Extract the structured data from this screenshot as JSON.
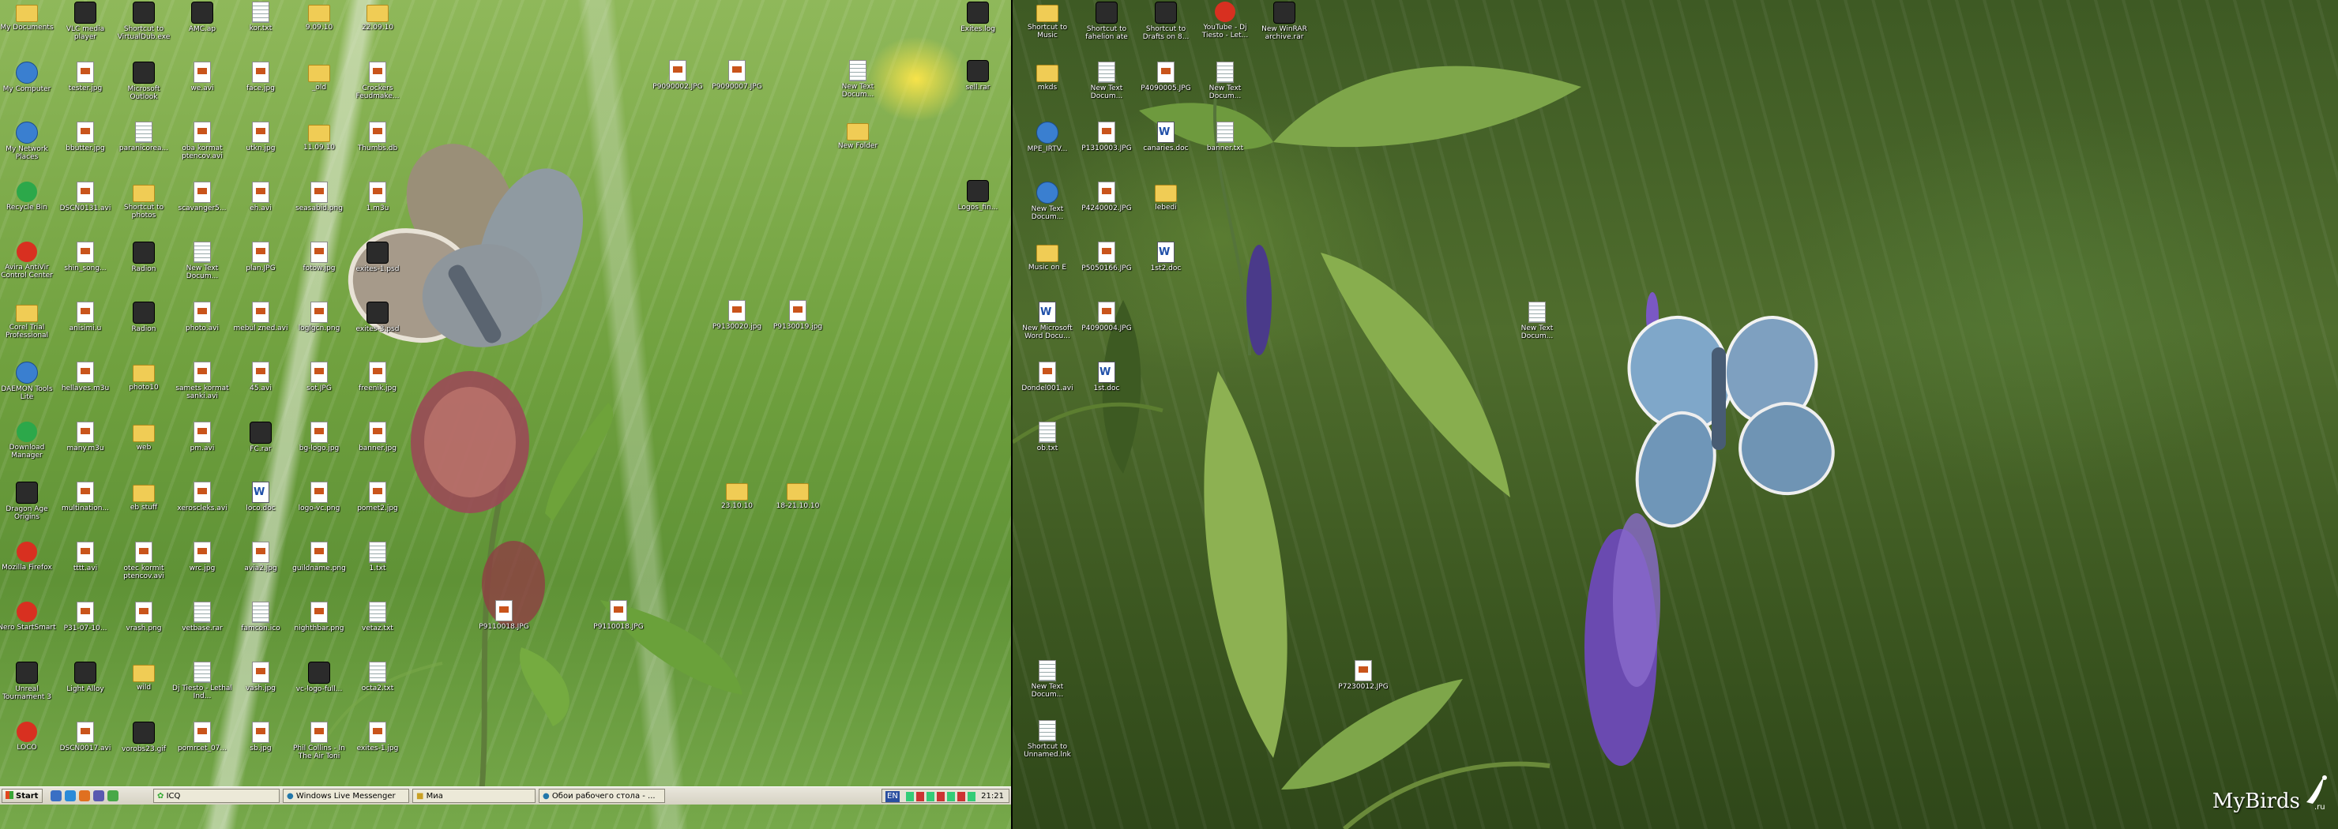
{
  "desktop_left": {
    "icons": [
      {
        "label": "My Documents",
        "type": "folder"
      },
      {
        "label": "VLC media player",
        "type": "exe"
      },
      {
        "label": "Shortcut to VirtualDub.exe",
        "type": "exe"
      },
      {
        "label": "AMC.ap",
        "type": "exe"
      },
      {
        "label": "kor.txt",
        "type": "txt"
      },
      {
        "label": "9.09.10",
        "type": "folder"
      },
      {
        "label": "22.09.10",
        "type": "folder"
      },
      {
        "label": "My Computer",
        "type": "net"
      },
      {
        "label": "tester.jpg",
        "type": "file"
      },
      {
        "label": "Microsoft Outlook",
        "type": "exe"
      },
      {
        "label": "we.avi",
        "type": "file"
      },
      {
        "label": "face.jpg",
        "type": "file"
      },
      {
        "label": "_old",
        "type": "folder"
      },
      {
        "label": "Crockers Feudmake...",
        "type": "file"
      },
      {
        "label": "My Network Places",
        "type": "net"
      },
      {
        "label": "bbutter.jpg",
        "type": "file"
      },
      {
        "label": "paranicorea...",
        "type": "txt"
      },
      {
        "label": "oba kormat ptencov.avi",
        "type": "file"
      },
      {
        "label": "utkn.jpg",
        "type": "file"
      },
      {
        "label": "11.09.10",
        "type": "folder"
      },
      {
        "label": "Thumbs.db",
        "type": "file"
      },
      {
        "label": "Recycle Bin",
        "type": "green"
      },
      {
        "label": "DSCN0131.avi",
        "type": "file"
      },
      {
        "label": "Shortcut to photos",
        "type": "folder"
      },
      {
        "label": "scavanger5...",
        "type": "file"
      },
      {
        "label": "eh.avi",
        "type": "file"
      },
      {
        "label": "seasabid.png",
        "type": "file"
      },
      {
        "label": "1.m3u",
        "type": "file"
      },
      {
        "label": "Avira AntiVir Control Center",
        "type": "red"
      },
      {
        "label": "shin_song...",
        "type": "file"
      },
      {
        "label": "Radion",
        "type": "exe"
      },
      {
        "label": "New Text Docum...",
        "type": "txt"
      },
      {
        "label": "plan.JPG",
        "type": "file"
      },
      {
        "label": "fotow.jpg",
        "type": "file"
      },
      {
        "label": "exites-1.psd",
        "type": "exe"
      },
      {
        "label": "Corel Trial Professional",
        "type": "folder"
      },
      {
        "label": "anisimi.u",
        "type": "file"
      },
      {
        "label": "Radion",
        "type": "exe"
      },
      {
        "label": "photo.avi",
        "type": "file"
      },
      {
        "label": "mebul zned.avi",
        "type": "file"
      },
      {
        "label": "loglgcn.png",
        "type": "file"
      },
      {
        "label": "exites-3.psd",
        "type": "exe"
      },
      {
        "label": "DAEMON Tools Lite",
        "type": "net"
      },
      {
        "label": "hellaves.m3u",
        "type": "file"
      },
      {
        "label": "photo10",
        "type": "folder"
      },
      {
        "label": "samets kormat sanki.avi",
        "type": "file"
      },
      {
        "label": "45.avi",
        "type": "file"
      },
      {
        "label": "sot.JPG",
        "type": "file"
      },
      {
        "label": "freenik.jpg",
        "type": "file"
      },
      {
        "label": "Download Manager",
        "type": "green"
      },
      {
        "label": "many.m3u",
        "type": "file"
      },
      {
        "label": "web",
        "type": "folder"
      },
      {
        "label": "pm.avi",
        "type": "file"
      },
      {
        "label": "FC.rar",
        "type": "exe"
      },
      {
        "label": "bg-logo.jpg",
        "type": "file"
      },
      {
        "label": "banner.jpg",
        "type": "file"
      },
      {
        "label": "Dragon Age Origins",
        "type": "exe"
      },
      {
        "label": "multination...",
        "type": "file"
      },
      {
        "label": "eb stuff",
        "type": "folder"
      },
      {
        "label": "xeroscleks.avi",
        "type": "file"
      },
      {
        "label": "loco.doc",
        "type": "doc"
      },
      {
        "label": "logo-vc.png",
        "type": "file"
      },
      {
        "label": "pomet2.jpg",
        "type": "file"
      },
      {
        "label": "Mozilla Firefox",
        "type": "red"
      },
      {
        "label": "tttt.avi",
        "type": "file"
      },
      {
        "label": "otec kormit ptencov.avi",
        "type": "file"
      },
      {
        "label": "wrc.jpg",
        "type": "file"
      },
      {
        "label": "avia2.jpg",
        "type": "file"
      },
      {
        "label": "guildname.png",
        "type": "file"
      },
      {
        "label": "1.txt",
        "type": "txt"
      },
      {
        "label": "Nero StartSmart",
        "type": "red"
      },
      {
        "label": "P31-07-10...",
        "type": "file"
      },
      {
        "label": "vrash.png",
        "type": "file"
      },
      {
        "label": "vetbase.rar",
        "type": "txt"
      },
      {
        "label": "famcon.ico",
        "type": "txt"
      },
      {
        "label": "nighthbar.png",
        "type": "file"
      },
      {
        "label": "vetaz.txt",
        "type": "txt"
      },
      {
        "label": "Unreal Tournament 3",
        "type": "exe"
      },
      {
        "label": "Light Alloy",
        "type": "exe"
      },
      {
        "label": "wild",
        "type": "folder"
      },
      {
        "label": "Dj Tiesto - Lethal Ind...",
        "type": "txt"
      },
      {
        "label": "vash.jpg",
        "type": "file"
      },
      {
        "label": "vc-logo-full...",
        "type": "exe"
      },
      {
        "label": "octa2.txt",
        "type": "txt"
      },
      {
        "label": "LOCO",
        "type": "red"
      },
      {
        "label": "DSCN0017.avi",
        "type": "file"
      },
      {
        "label": "vorobs23.gif",
        "type": "exe"
      },
      {
        "label": "pomrcet_07...",
        "type": "file"
      },
      {
        "label": "sb.jpg",
        "type": "file"
      },
      {
        "label": "Phil Collins - In The Air Toni",
        "type": "file"
      },
      {
        "label": "exites-1.jpg",
        "type": "file"
      }
    ],
    "loose_icons": [
      {
        "label": "Exites.log",
        "type": "exe"
      },
      {
        "label": "P9090002.JPG",
        "type": "file"
      },
      {
        "label": "P9090007.JPG",
        "type": "file"
      },
      {
        "label": "New Text Docum...",
        "type": "txt"
      },
      {
        "label": "sell.rar",
        "type": "exe"
      },
      {
        "label": "New Folder",
        "type": "folder"
      },
      {
        "label": "Logos_fin...",
        "type": "exe"
      },
      {
        "label": "P9130020.jpg",
        "type": "file"
      },
      {
        "label": "P9130019.jpg",
        "type": "file"
      },
      {
        "label": "23.10.10",
        "type": "folder"
      },
      {
        "label": "18-21.10.10",
        "type": "folder"
      },
      {
        "label": "P9110018.JPG",
        "type": "file"
      },
      {
        "label": "P9110018.JPG",
        "type": "file"
      }
    ]
  },
  "desktop_right": {
    "icons": [
      {
        "label": "Shortcut to Music",
        "type": "folder"
      },
      {
        "label": "Shortcut to fahelion ate",
        "type": "exe"
      },
      {
        "label": "Shortcut to Drafts on 8...",
        "type": "exe"
      },
      {
        "label": "YouTube - Dj Tiesto - Let...",
        "type": "red"
      },
      {
        "label": "New WinRAR archive.rar",
        "type": "exe"
      },
      {
        "label": "mkds",
        "type": "folder"
      },
      {
        "label": "New Text Docum...",
        "type": "txt"
      },
      {
        "label": "P4090005.JPG",
        "type": "file"
      },
      {
        "label": "New Text Docum...",
        "type": "txt"
      },
      {
        "label": "MPE_IRTV...",
        "type": "net"
      },
      {
        "label": "P1310003.JPG",
        "type": "file"
      },
      {
        "label": "canaries.doc",
        "type": "doc"
      },
      {
        "label": "banner.txt",
        "type": "txt"
      },
      {
        "label": "New Text Docum...",
        "type": "net"
      },
      {
        "label": "P4240002.JPG",
        "type": "file"
      },
      {
        "label": "lebedi",
        "type": "folder"
      },
      {
        "label": "Music on E",
        "type": "folder"
      },
      {
        "label": "P5050166.JPG",
        "type": "file"
      },
      {
        "label": "1st2.doc",
        "type": "doc"
      },
      {
        "label": "New Microsoft Word Docu...",
        "type": "doc"
      },
      {
        "label": "P4090004.JPG",
        "type": "file"
      },
      {
        "label": "Dondel001.avi",
        "type": "file"
      },
      {
        "label": "1st.doc",
        "type": "doc"
      },
      {
        "label": "ob.txt",
        "type": "txt"
      },
      {
        "label": "New Text Docum...",
        "type": "txt"
      },
      {
        "label": "P7230012.JPG",
        "type": "file"
      },
      {
        "label": "New Text Docum...",
        "type": "txt"
      },
      {
        "label": "Shortcut to Unnamed.lnk",
        "type": "txt"
      }
    ]
  },
  "taskbar": {
    "start_label": "Start",
    "buttons": [
      "ICQ",
      "Windows Live Messenger",
      "Миа",
      "Обои рабочего стола - ..."
    ],
    "tray_lang": "EN",
    "clock": "21:21"
  },
  "watermark": "MyBirds",
  "watermark_tld": ".ru"
}
